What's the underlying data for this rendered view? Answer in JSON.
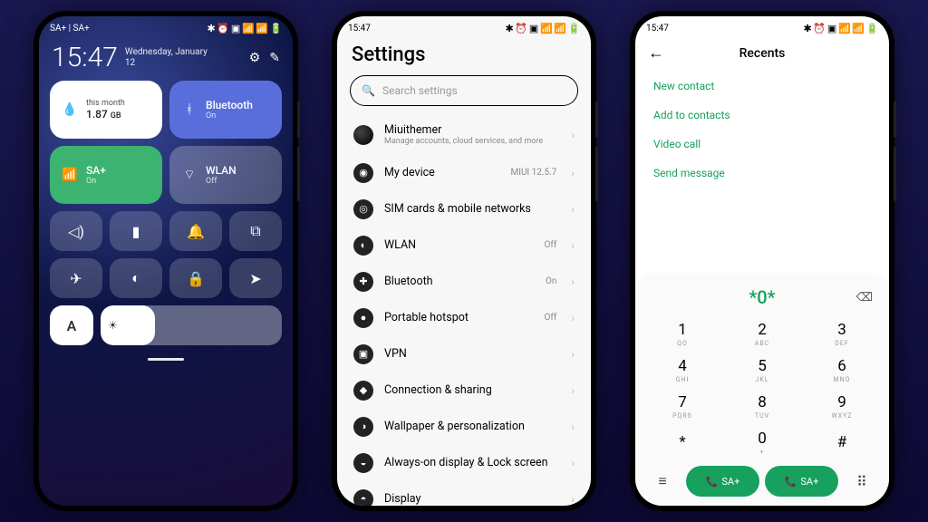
{
  "status_bar": {
    "time": "15:47",
    "carrier": "SA+ | SA+",
    "icons": "✱ ⏰ ▣ 📶 📶 🔋"
  },
  "phone1": {
    "clock_time": "15:47",
    "clock_day": "Wednesday, January",
    "clock_date": "12",
    "tiles": {
      "data": {
        "label": "this month",
        "value": "1.87",
        "unit": "GB"
      },
      "bt": {
        "label": "Bluetooth",
        "state": "On"
      },
      "sim": {
        "label": "SA+",
        "state": "On"
      },
      "wlan": {
        "label": "WLAN",
        "state": "Off"
      }
    },
    "auto_label": "A"
  },
  "phone2": {
    "title": "Settings",
    "search_placeholder": "Search settings",
    "account": {
      "name": "Miuithemer",
      "sub": "Manage accounts, cloud services, and more"
    },
    "items": [
      {
        "label": "My device",
        "right": "MIUI 12.5.7",
        "icon": "◉"
      },
      {
        "label": "SIM cards & mobile networks",
        "right": "",
        "icon": "◎"
      },
      {
        "label": "WLAN",
        "right": "Off",
        "icon": "◐"
      },
      {
        "label": "Bluetooth",
        "right": "On",
        "icon": "✚"
      },
      {
        "label": "Portable hotspot",
        "right": "Off",
        "icon": "●"
      },
      {
        "label": "VPN",
        "right": "",
        "icon": "▣"
      },
      {
        "label": "Connection & sharing",
        "right": "",
        "icon": "◆"
      },
      {
        "label": "Wallpaper & personalization",
        "right": "",
        "icon": "◑"
      },
      {
        "label": "Always-on display & Lock screen",
        "right": "",
        "icon": "◒"
      },
      {
        "label": "Display",
        "right": "",
        "icon": "◓"
      }
    ]
  },
  "phone3": {
    "header": "Recents",
    "menu": [
      "New contact",
      "Add to contacts",
      "Video call",
      "Send message"
    ],
    "number": "*0*",
    "keys": [
      {
        "d": "1",
        "w": "QO"
      },
      {
        "d": "2",
        "w": "ABC"
      },
      {
        "d": "3",
        "w": "DEF"
      },
      {
        "d": "4",
        "w": "GHI"
      },
      {
        "d": "5",
        "w": "JKL"
      },
      {
        "d": "6",
        "w": "MNO"
      },
      {
        "d": "7",
        "w": "PQRS"
      },
      {
        "d": "8",
        "w": "TUV"
      },
      {
        "d": "9",
        "w": "WXYZ"
      },
      {
        "d": "*",
        "w": ""
      },
      {
        "d": "0",
        "w": "+"
      },
      {
        "d": "#",
        "w": ""
      }
    ],
    "call_labels": [
      "SA+",
      "SA+"
    ]
  }
}
